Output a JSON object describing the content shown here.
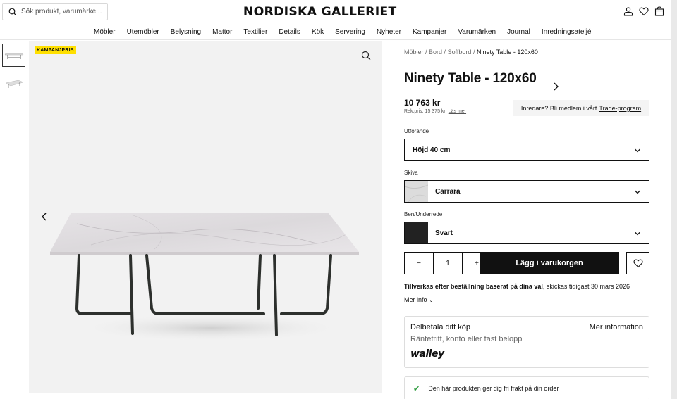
{
  "header": {
    "search_placeholder": "Sök produkt, varumärke...",
    "logo": "NORDISKA GALLERIET"
  },
  "nav": [
    "Möbler",
    "Utemöbler",
    "Belysning",
    "Mattor",
    "Textilier",
    "Details",
    "Kök",
    "Servering",
    "Nyheter",
    "Kampanjer",
    "Varumärken",
    "Journal",
    "Inredningsateljé"
  ],
  "gallery": {
    "badge": "KAMPANJPRIS"
  },
  "breadcrumb": {
    "items": [
      "Möbler",
      "Bord",
      "Soffbord"
    ],
    "current": "Ninety Table - 120x60"
  },
  "product": {
    "title": "Ninety Table - 120x60",
    "price": "10 763 kr",
    "rek_price": "Rek.pris: 15 375 kr",
    "read_more": "Läs mer",
    "trade_text": "Inredare? Bli medlem i vårt",
    "trade_link": "Trade-program"
  },
  "options": {
    "utforande_label": "Utförande",
    "utforande_value": "Höjd 40 cm",
    "skiva_label": "Skiva",
    "skiva_value": "Carrara",
    "ben_label": "Ben/Underrede",
    "ben_value": "Svart"
  },
  "purchase": {
    "qty_minus": "−",
    "qty": "1",
    "qty_plus": "+",
    "add_to_cart": "Lägg i varukorgen"
  },
  "shipping": {
    "bold": "Tillverkas efter beställning baserat på dina val",
    "rest": ", skickas tidigast 30 mars 2026",
    "more_info": "Mer info"
  },
  "walley": {
    "title": "Delbetala ditt köp",
    "more": "Mer information",
    "subtitle": "Räntefritt, konto eller fast belopp",
    "brand": "walley"
  },
  "free_shipping": {
    "text": "Den här produkten ger dig fri frakt på din order"
  }
}
